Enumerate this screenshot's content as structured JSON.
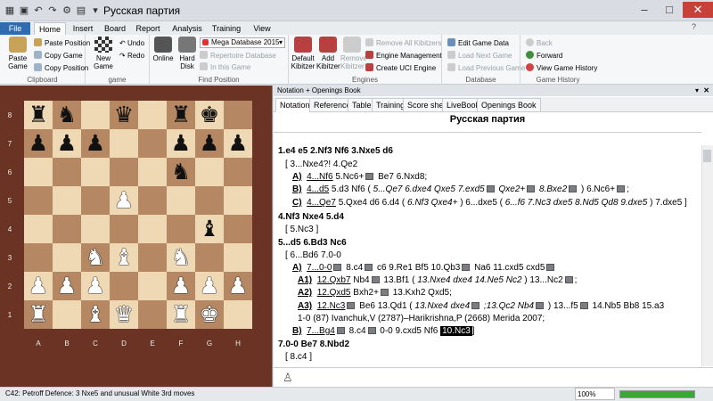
{
  "window": {
    "title": "Русская партия"
  },
  "ribbon_tabs": [
    "File",
    "Home",
    "Insert",
    "Board",
    "Report",
    "Analysis",
    "Training",
    "View"
  ],
  "groups": {
    "clipboard": {
      "label": "Clipboard",
      "paste_game": "Paste Game",
      "paste_position": "Paste Position",
      "copy_game": "Copy Game",
      "copy_position": "Copy Position"
    },
    "game": {
      "label": "game",
      "new_game": "New Game",
      "undo": "Undo",
      "redo": "Redo"
    },
    "find_position": {
      "label": "Find Position",
      "online": "Online",
      "hard_disk": "Hard Disk",
      "database": "Mega Database 2015",
      "repertoire": "Repertoire Database",
      "in_this_game": "In this Game"
    },
    "engines": {
      "label": "Engines",
      "default_kibitzer": "Default Kibitzer",
      "add_kibitzer": "Add Kibitzer",
      "remove_kibitzer": "Remove Kibitzer",
      "remove_all": "Remove All Kibitzers",
      "engine_mgmt": "Engine Management",
      "create_uci": "Create UCI Engine"
    },
    "database": {
      "label": "Database",
      "edit_game_data": "Edit Game Data",
      "load_next": "Load Next Game",
      "load_previous": "Load Previous Game"
    },
    "game_history": {
      "label": "Game History",
      "back": "Back",
      "forward": "Forward",
      "view_history": "View Game History"
    }
  },
  "board": {
    "ranks": [
      "8",
      "7",
      "6",
      "5",
      "4",
      "3",
      "2",
      "1"
    ],
    "files": [
      "A",
      "B",
      "C",
      "D",
      "E",
      "F",
      "G",
      "H"
    ],
    "rows": [
      [
        "bR",
        "bN",
        "",
        "bQ",
        "",
        "bR",
        "bK",
        ""
      ],
      [
        "bP",
        "bP",
        "bP",
        "",
        "",
        "bP",
        "bP",
        "bP"
      ],
      [
        "",
        "",
        "",
        "",
        "",
        "bN",
        "",
        ""
      ],
      [
        "",
        "",
        "",
        "wP",
        "",
        "",
        "",
        ""
      ],
      [
        "",
        "",
        "",
        "",
        "",
        "",
        "bB",
        ""
      ],
      [
        "",
        "",
        "wN",
        "wB",
        "",
        "wN",
        "",
        ""
      ],
      [
        "wP",
        "wP",
        "wP",
        "",
        "",
        "wP",
        "wP",
        "wP"
      ],
      [
        "wR",
        "",
        "wB",
        "wQ",
        "",
        "wR",
        "wK",
        ""
      ]
    ]
  },
  "notation": {
    "header": "Notation + Openings Book",
    "tabs": [
      "Notation",
      "Reference",
      "Table",
      "Training",
      "Score sheet",
      "LiveBook",
      "Openings Book"
    ],
    "game_title": "Русская партия"
  },
  "moves": {
    "l1": "1.e4   e5  2.Nf3  Nf6  3.Nxe5  d6",
    "l2": "[ 3...Nxe4?!  4.Qe2",
    "l3a": "A)",
    "l3b": "4...Nf6",
    "l3c": " 5.Nc6+",
    "l3d": " Be7  6.Nxd8;",
    "l4a": "B)",
    "l4b": "4...d5",
    "l4c": " 5.d3  Nf6  (",
    "l4d": " 5...Qe7  6.dxe4  Qxe5  7.exd5",
    "l4e": " Qxe2+",
    "l4f": " 8.Bxe2",
    "l4g": " ) 6.Nc6+",
    "l4h": ";",
    "l5a": "C)",
    "l5b": "4...Qe7",
    "l5c": " 5.Qxe4  d6  6.d4  (",
    "l5d": " 6.Nf3  Qxe4+ ",
    "l5e": ") 6...dxe5  (",
    "l5f": " 6...f6  7.Nc3  dxe5  8.Nd5  Qd8  9.dxe5",
    "l5g": " ) 7.dxe5 ]",
    "l6": "4.Nf3  Nxe4  5.d4",
    "l7": "[ 5.Nc3 ]",
    "l8": "5...d5  6.Bd3  Nc6",
    "l9": "[ 6...Bd6  7.0-0",
    "l10a": "A)",
    "l10b": "7...0-0",
    "l10c": " 8.c4",
    "l10d": " c6  9.Re1  Bf5  10.Qb3",
    "l10e": " Na6  11.cxd5  cxd5",
    "l11a": "A1)",
    "l11b": "12.Qxb7",
    "l11c": " Nb4",
    "l11d": " 13.Bf1  (",
    "l11e": " 13.Nxe4  dxe4  14.Ne5  Nc2",
    "l11f": " ) 13...Nc2",
    "l11g": ";",
    "l12a": "A2)",
    "l12b": "12.Qxd5",
    "l12c": " Bxh2+",
    "l12d": " 13.Kxh2  Qxd5;",
    "l13a": "A3)",
    "l13b": "12.Nc3",
    "l13c": " Be6  13.Qd1  (",
    "l13d": " 13.Nxe4  dxe4",
    "l13e": " ;13.Qc2  Nb4",
    "l13f": " ) 13...f5",
    "l13g": " 14.Nb5  Bb8  15.a3",
    "l14": "1-0 (87) Ivanchuk,V (2787)–Harikrishna,P (2668) Merida 2007;",
    "l15a": "B)",
    "l15b": "7...Bg4",
    "l15c": " 8.c4",
    "l15d": " 0-0  9.cxd5  Nf6",
    "l15e": "10.Nc3",
    "l15f": "]",
    "l16": "7.0-0  Be7  8.Nbd2",
    "l17": "[ 8.c4 ]"
  },
  "status": {
    "text": "C42: Petroff Defence: 3 Nxe5 and unusual White 3rd moves",
    "zoom": "100%",
    "progress": 1.0
  }
}
